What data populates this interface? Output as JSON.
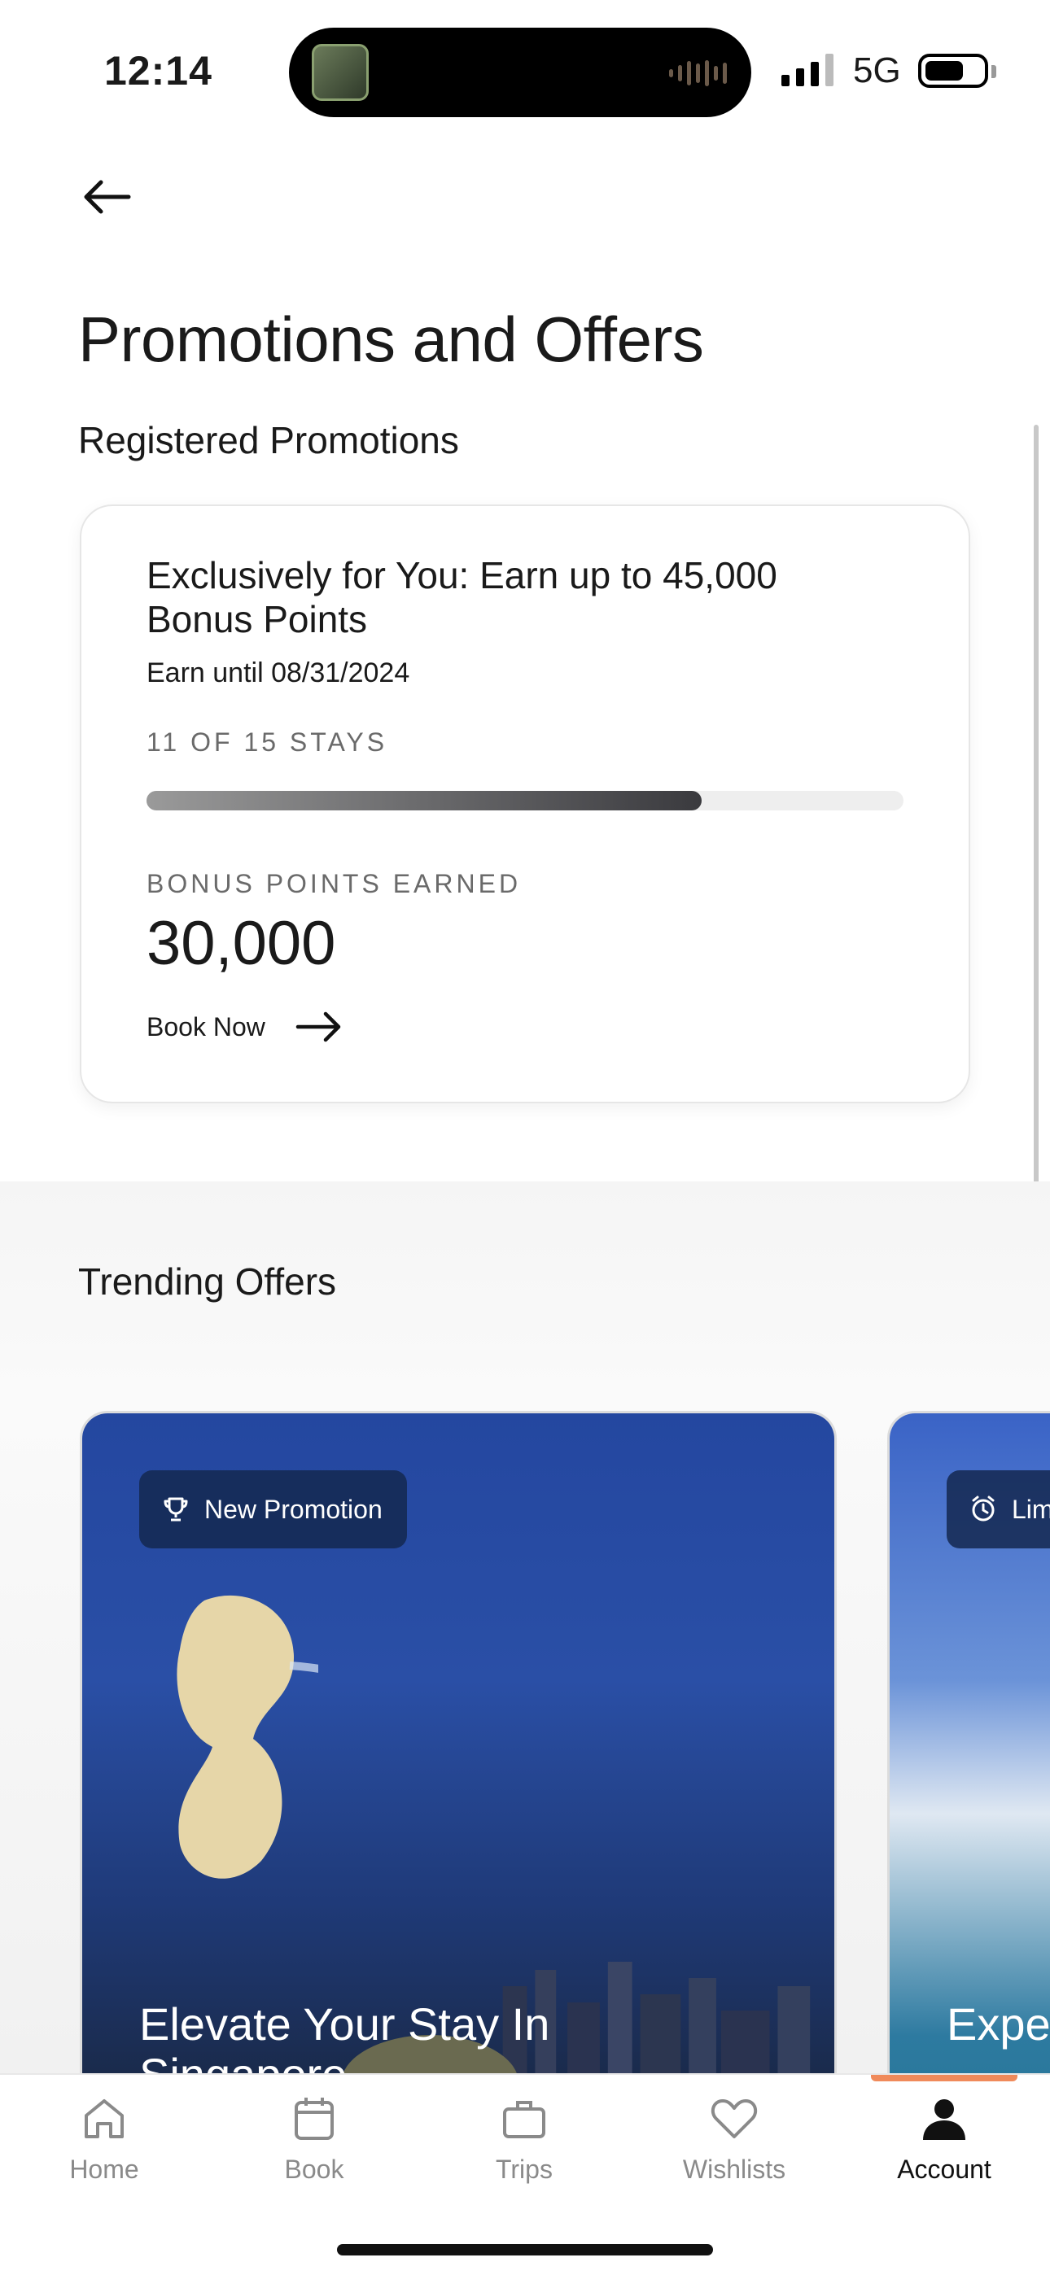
{
  "status_bar": {
    "time": "12:14",
    "network": "5G"
  },
  "header": {
    "title": "Promotions and Offers"
  },
  "registered": {
    "section_title": "Registered Promotions",
    "promo": {
      "title": "Exclusively for You: Earn up to 45,000 Bonus Points",
      "subtitle": "Earn until 08/31/2024",
      "stays_label": "11 OF 15 STAYS",
      "progress_fraction": 0.733,
      "bonus_label": "BONUS POINTS EARNED",
      "bonus_value": "30,000",
      "cta": "Book Now"
    }
  },
  "trending": {
    "section_title": "Trending Offers",
    "offers": [
      {
        "badge": "New Promotion",
        "badge_icon": "trophy-icon",
        "title": "Elevate Your Stay In Singapore"
      },
      {
        "badge": "Lim",
        "badge_icon": "alarm-clock-icon",
        "title": "Expe Beyo"
      }
    ]
  },
  "nav": {
    "items": [
      {
        "label": "Home",
        "icon": "home-icon"
      },
      {
        "label": "Book",
        "icon": "calendar-icon"
      },
      {
        "label": "Trips",
        "icon": "briefcase-icon"
      },
      {
        "label": "Wishlists",
        "icon": "heart-icon"
      },
      {
        "label": "Account",
        "icon": "person-icon",
        "active": true
      }
    ]
  },
  "colors": {
    "accent": "#f08a5a",
    "badge_bg": "#14284f",
    "card_border": "#e6e6e6"
  }
}
